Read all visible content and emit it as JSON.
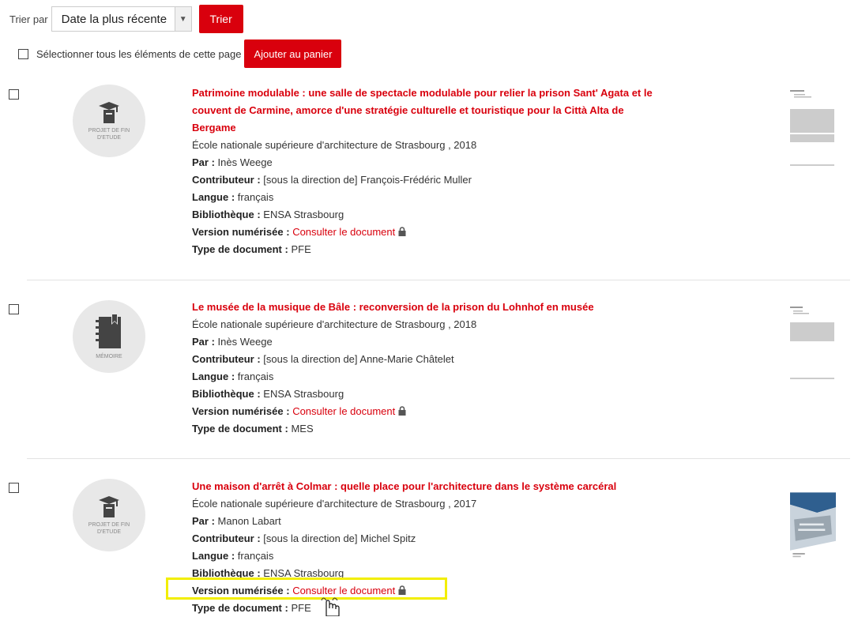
{
  "sort": {
    "label": "Trier par",
    "selected": "Date la plus récente",
    "button": "Trier"
  },
  "selection": {
    "label": "Sélectionner tous les éléments de cette page",
    "cart_button": "Ajouter au panier"
  },
  "labels": {
    "author": "Par :",
    "contributor": "Contributeur :",
    "language": "Langue :",
    "library": "Bibliothèque :",
    "digital": "Version numérisée :",
    "doctype": "Type de document :"
  },
  "records": [
    {
      "title": "Patrimoine modulable : une salle de spectacle modulable pour relier la prison Sant' Agata et le couvent de Carmine, amorce d'une stratégie culturelle et touristique pour la Città Alta de Bergame",
      "publisher": "École nationale supérieure d'architecture de Strasbourg , 2018",
      "author": "Inès Weege",
      "contributor": "[sous la direction de] François-Frédéric Muller",
      "language": "français",
      "library": "ENSA Strasbourg",
      "digital_link": "Consulter le document",
      "doctype": "PFE",
      "thumb_caption": "PROJET DE FIN D'ETUDE",
      "thumb_icon": "graduation-book-icon"
    },
    {
      "title": "Le musée de la musique de Bâle : reconversion de la prison du Lohnhof en musée",
      "publisher": "École nationale supérieure d'architecture de Strasbourg , 2018",
      "author": "Inès Weege",
      "contributor": "[sous la direction de] Anne-Marie Châtelet",
      "language": "français",
      "library": "ENSA Strasbourg",
      "digital_link": "Consulter le document",
      "doctype": "MES",
      "thumb_caption": "MÉMOIRE",
      "thumb_icon": "notebook-icon"
    },
    {
      "title": "Une maison d'arrêt à Colmar : quelle place pour l'architecture dans le système carcéral",
      "publisher": "École nationale supérieure d'architecture de Strasbourg , 2017",
      "author": "Manon Labart",
      "contributor": "[sous la direction de] Michel Spitz",
      "language": "français",
      "library": "ENSA Strasbourg",
      "digital_link": "Consulter le document",
      "doctype": "PFE",
      "thumb_caption": "PROJET DE FIN D'ETUDE",
      "thumb_icon": "graduation-book-icon"
    }
  ],
  "colors": {
    "accent": "#d9000d",
    "highlight": "#f2ee00"
  }
}
